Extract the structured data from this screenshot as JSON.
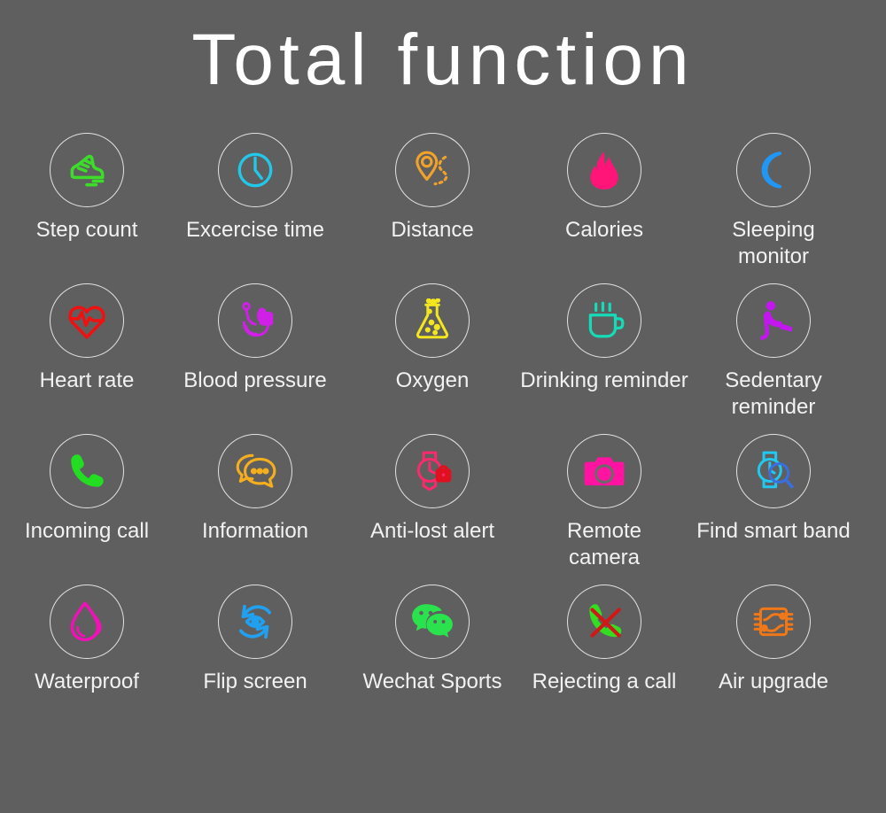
{
  "page": {
    "title": "Total function",
    "background_color": "#5f5f5f",
    "title_color": "#ffffff",
    "label_color": "#f2f2f2",
    "circle_ring_color": "#e2e2e2"
  },
  "features": [
    {
      "label": "Step count",
      "icon": "running-shoe-icon",
      "color": "#3ddb2a",
      "column": 0,
      "row": 0
    },
    {
      "label": "Excercise time",
      "icon": "clock-icon",
      "color": "#22c8e8",
      "column": 1,
      "row": 0
    },
    {
      "label": "Distance",
      "icon": "map-pin-route-icon",
      "color": "#f0a22a",
      "column": 2,
      "row": 0
    },
    {
      "label": "Calories",
      "icon": "flame-icon",
      "color": "#ff1478",
      "column": 3,
      "row": 0
    },
    {
      "label": "Sleeping\nmonitor",
      "icon": "crescent-moon-icon",
      "color": "#2196f3",
      "column": 4,
      "row": 0
    },
    {
      "label": "Heart rate",
      "icon": "heart-ecg-icon",
      "color": "#f01010",
      "column": 0,
      "row": 1
    },
    {
      "label": "Blood pressure",
      "icon": "blood-pressure-monitor-icon",
      "color": "#d020e8",
      "column": 1,
      "row": 1
    },
    {
      "label": "Oxygen",
      "icon": "flask-bubbles-icon",
      "color": "#f4e61e",
      "column": 2,
      "row": 1
    },
    {
      "label": "Drinking reminder",
      "icon": "coffee-cup-icon",
      "color": "#15dcb8",
      "column": 3,
      "row": 1
    },
    {
      "label": "Sedentary\nreminder",
      "icon": "sitting-person-icon",
      "color": "#c317ef",
      "column": 4,
      "row": 1
    },
    {
      "label": "Incoming call",
      "icon": "phone-handset-icon",
      "color": "#22dd22",
      "column": 0,
      "row": 2
    },
    {
      "label": "Information",
      "icon": "speech-bubbles-icon",
      "color": "#f4ae1e",
      "column": 1,
      "row": 2
    },
    {
      "label": "Anti-lost alert",
      "icon": "watch-lock-icon",
      "color": "#fb2a6d",
      "column": 2,
      "row": 2
    },
    {
      "label": "Remote\ncamera",
      "icon": "camera-icon",
      "color": "#ff13a0",
      "column": 3,
      "row": 2
    },
    {
      "label": "Find smart band",
      "icon": "watch-magnifier-icon",
      "color": "#22c8f0",
      "column": 4,
      "row": 2
    },
    {
      "label": "Waterproof",
      "icon": "water-droplet-icon",
      "color": "#f410b8",
      "column": 0,
      "row": 3
    },
    {
      "label": "Flip screen",
      "icon": "rotate-eye-icon",
      "color": "#22a0f0",
      "column": 1,
      "row": 3
    },
    {
      "label": "Wechat Sports",
      "icon": "wechat-bubbles-icon",
      "color": "#2ae24e",
      "column": 2,
      "row": 3
    },
    {
      "label": "Rejecting a call",
      "icon": "phone-reject-icon",
      "color": "#33dd22",
      "column": 3,
      "row": 3
    },
    {
      "label": "Air upgrade",
      "icon": "ota-chip-icon",
      "color": "#f07818",
      "column": 4,
      "row": 3
    }
  ]
}
